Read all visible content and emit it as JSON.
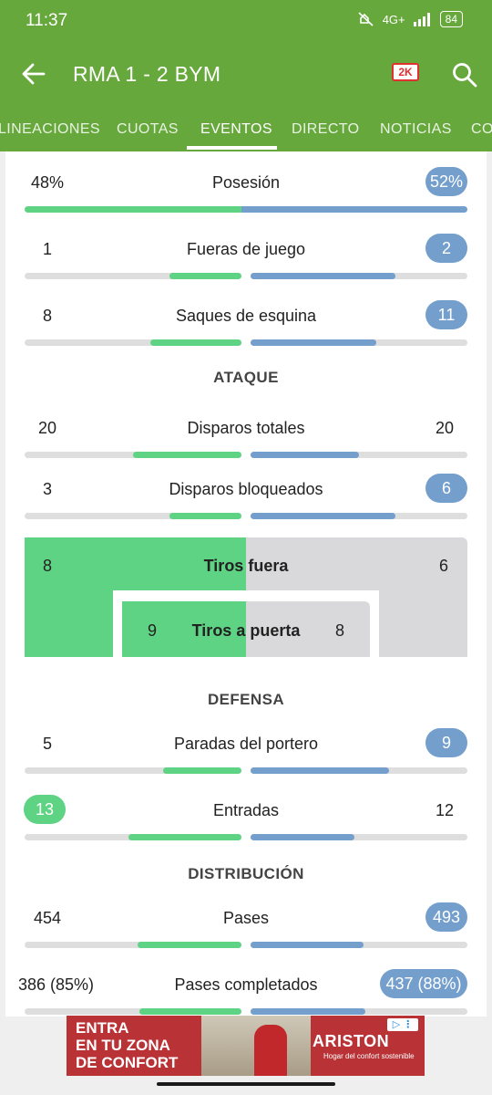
{
  "status_bar": {
    "time": "11:37",
    "network": "4G+",
    "battery": "84"
  },
  "toolbar": {
    "title": "RMA 1 - 2 BYM",
    "badge": "2K"
  },
  "tabs": [
    {
      "label": "LINEACIONES"
    },
    {
      "label": "CUOTAS"
    },
    {
      "label": "EVENTOS"
    },
    {
      "label": "DIRECTO"
    },
    {
      "label": "NOTICIAS"
    },
    {
      "label": "CO"
    }
  ],
  "active_tab": "EVENTOS",
  "colors": {
    "header": "#67a83c",
    "home": "#5fd384",
    "away": "#749fcd",
    "track": "#dedede"
  },
  "stats": [
    {
      "label": "Posesión",
      "home": "48%",
      "away": "52%",
      "home_share": 0.48,
      "away_share": 0.52
    },
    {
      "label": "Fueras de juego",
      "home": "1",
      "away": "2",
      "home_share": 0.33,
      "away_share": 0.67
    },
    {
      "label": "Saques de esquina",
      "home": "8",
      "away": "11",
      "home_share": 0.42,
      "away_share": 0.58
    }
  ],
  "sections": {
    "attack": "ATAQUE",
    "defense": "DEFENSA",
    "distribution": "DISTRIBUCIÓN"
  },
  "attack": [
    {
      "label": "Disparos totales",
      "home": "20",
      "away": "20",
      "home_share": 0.5,
      "away_share": 0.5
    },
    {
      "label": "Disparos bloqueados",
      "home": "3",
      "away": "6",
      "home_share": 0.33,
      "away_share": 0.67
    }
  ],
  "shots": {
    "off_target": {
      "label": "Tiros fuera",
      "home": "8",
      "away": "6"
    },
    "on_target": {
      "label": "Tiros a puerta",
      "home": "9",
      "away": "8"
    }
  },
  "defense": [
    {
      "label": "Paradas del portero",
      "home": "5",
      "away": "9",
      "home_share": 0.36,
      "away_share": 0.64
    },
    {
      "label": "Entradas",
      "home": "13",
      "away": "12",
      "home_share": 0.52,
      "away_share": 0.48
    }
  ],
  "distribution": [
    {
      "label": "Pases",
      "home": "454",
      "away": "493",
      "home_share": 0.48,
      "away_share": 0.52
    },
    {
      "label": "Pases completados",
      "home": "386 (85%)",
      "away": "437 (88%)",
      "home_share": 0.47,
      "away_share": 0.53
    }
  ],
  "ad": {
    "headline_1": "ENTRA",
    "headline_2": "EN TU ZONA",
    "headline_3": "DE CONFORT",
    "brand": "ARISTON",
    "tagline": "Hogar del confort sostenible"
  }
}
